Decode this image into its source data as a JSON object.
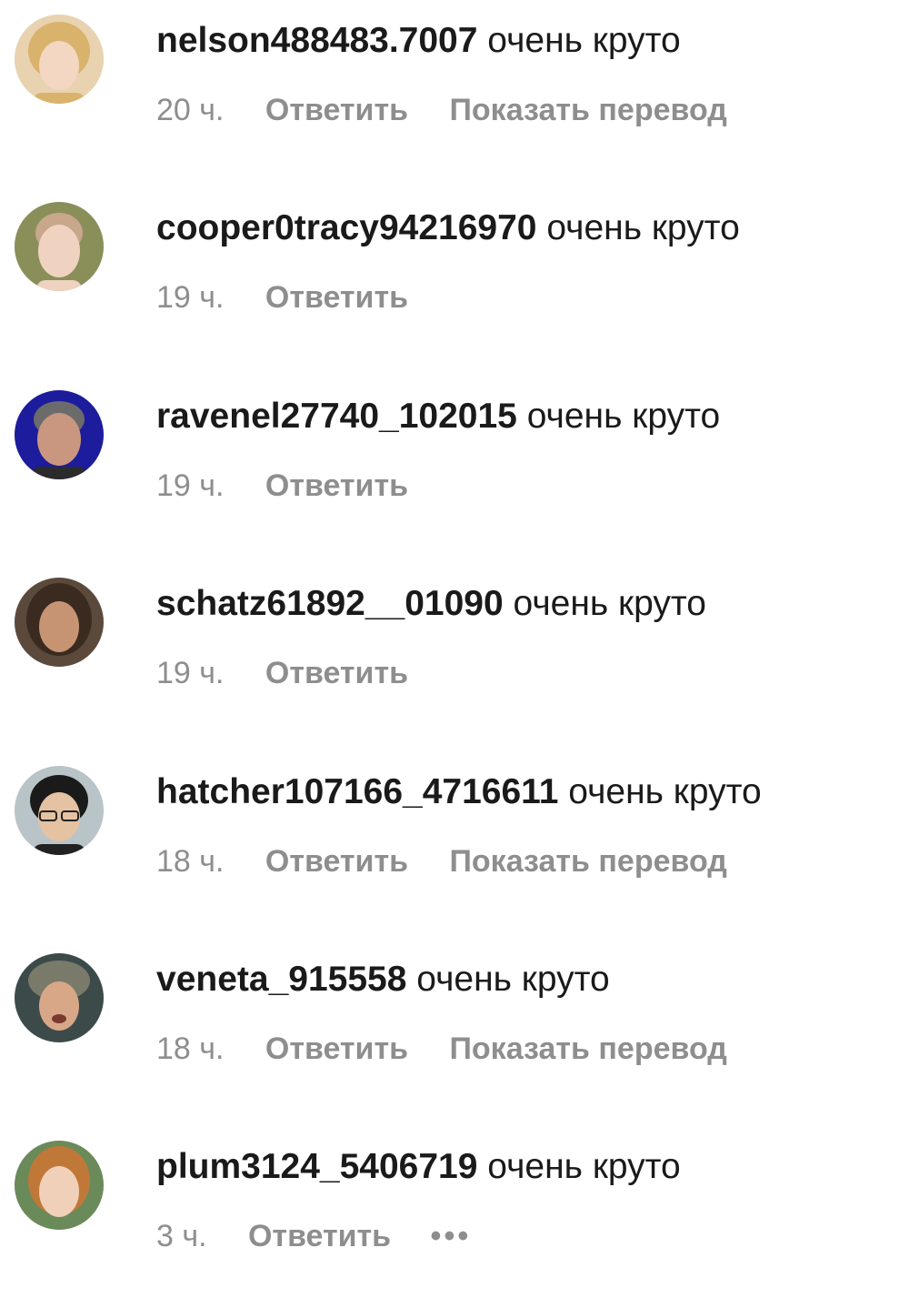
{
  "comments": [
    {
      "username": "nelson488483.7007",
      "text": "очень круто",
      "time": "20 ч.",
      "reply_label": "Ответить",
      "translate_label": "Показать перевод",
      "avatar_bg": "#e8d2b0",
      "avatar_face": "#f3d7c2",
      "avatar_hair": "#d9b26c"
    },
    {
      "username": "cooper0tracy94216970",
      "text": "очень круто",
      "time": "19 ч.",
      "reply_label": "Ответить",
      "avatar_bg": "#8a8f5a",
      "avatar_face": "#efd3c0",
      "avatar_hair": "#c8a78b"
    },
    {
      "username": "ravenel27740_102015",
      "text": "очень круто",
      "time": "19 ч.",
      "reply_label": "Ответить",
      "avatar_bg": "#1c1c9c",
      "avatar_face": "#c99780",
      "avatar_hair": "#6b6b6b"
    },
    {
      "username": "schatz61892__01090",
      "text": "очень круто",
      "time": "19 ч.",
      "reply_label": "Ответить",
      "avatar_bg": "#5b4a3c",
      "avatar_face": "#c69472",
      "avatar_hair": "#3a2a20"
    },
    {
      "username": "hatcher107166_4716611",
      "text": "очень круто",
      "time": "18 ч.",
      "reply_label": "Ответить",
      "translate_label": "Показать перевод",
      "avatar_bg": "#b9c4c9",
      "avatar_face": "#e5c2a1",
      "avatar_hair": "#1a1a1a"
    },
    {
      "username": "veneta_915558",
      "text": "очень круто",
      "time": "18 ч.",
      "reply_label": "Ответить",
      "translate_label": "Показать перевод",
      "avatar_bg": "#3c4a4a",
      "avatar_face": "#d7a788",
      "avatar_hair": "#4a3a2c"
    },
    {
      "username": "plum3124_5406719",
      "text": "очень круто",
      "time": "3 ч.",
      "reply_label": "Ответить",
      "more_label": "•••",
      "avatar_bg": "#6b8a5a",
      "avatar_face": "#f0d0b8",
      "avatar_hair": "#c07838"
    }
  ]
}
